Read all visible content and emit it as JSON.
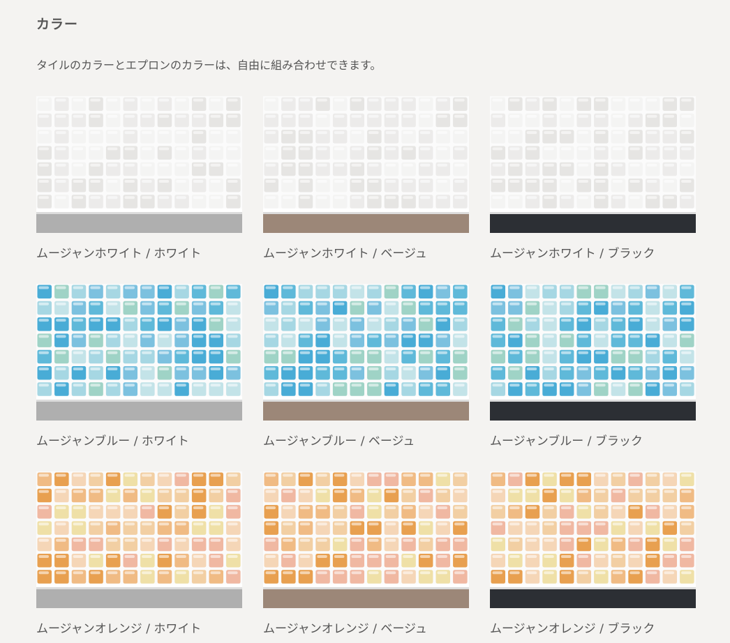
{
  "section": {
    "title": "カラー",
    "lead": "タイルのカラーとエプロンのカラーは、自由に組み合わせできます。"
  },
  "colors": {
    "tile_white": [
      "#f4f4f3",
      "#ecebea",
      "#e6e5e3"
    ],
    "tile_blue": [
      "#49acd6",
      "#7cc1df",
      "#a6d7e3",
      "#c3e3e8",
      "#9fd3c6",
      "#5fb9d9"
    ],
    "tile_orange": [
      "#e8a050",
      "#f0bb84",
      "#f2cfa3",
      "#efe0a7",
      "#f0b8a2",
      "#f5d6b7"
    ],
    "apron_white": "#afafaf",
    "apron_beige": "#9c8778",
    "apron_black": "#2c2f34",
    "grout": "#fbfbfb"
  },
  "variants": [
    {
      "label": "ムージャンホワイト / ホワイト",
      "tile": "white",
      "apron": "white"
    },
    {
      "label": "ムージャンホワイト / ベージュ",
      "tile": "white",
      "apron": "beige"
    },
    {
      "label": "ムージャンホワイト / ブラック",
      "tile": "white",
      "apron": "black"
    },
    {
      "label": "ムージャンブルー / ホワイト",
      "tile": "blue",
      "apron": "white"
    },
    {
      "label": "ムージャンブルー / ベージュ",
      "tile": "blue",
      "apron": "beige"
    },
    {
      "label": "ムージャンブルー / ブラック",
      "tile": "blue",
      "apron": "black"
    },
    {
      "label": "ムージャンオレンジ / ホワイト",
      "tile": "orange",
      "apron": "white"
    },
    {
      "label": "ムージャンオレンジ / ベージュ",
      "tile": "orange",
      "apron": "beige"
    },
    {
      "label": "ムージャンオレンジ / ブラック",
      "tile": "orange",
      "apron": "black"
    }
  ]
}
